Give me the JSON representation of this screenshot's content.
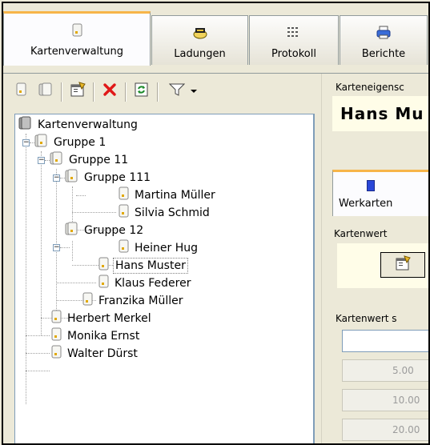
{
  "tabs": [
    {
      "label": "Kartenverwaltung",
      "icon": "card-icon",
      "active": true
    },
    {
      "label": "Ladungen",
      "icon": "charge-icon",
      "active": false
    },
    {
      "label": "Protokoll",
      "icon": "protocol-icon",
      "active": false
    },
    {
      "label": "Berichte",
      "icon": "printer-icon",
      "active": false
    }
  ],
  "toolbar": {
    "buttons": [
      "new-card-icon",
      "new-group-icon",
      "properties-icon",
      "delete-icon",
      "refresh-icon",
      "filter-icon",
      "dropdown-arrow-icon"
    ]
  },
  "tree": {
    "root": "Kartenverwaltung",
    "gruppe1": "Gruppe 1",
    "gruppe11": "Gruppe 11",
    "gruppe111": "Gruppe 111",
    "martina": "Martina Müller",
    "silvia": "Silvia Schmid",
    "gruppe12": "Gruppe 12",
    "heiner": "Heiner Hug",
    "hans": "Hans Muster",
    "klaus": "Klaus Federer",
    "franzika": "Franzika Müller",
    "herbert": "Herbert Merkel",
    "monika": "Monika Ernst",
    "walter": "Walter Dürst"
  },
  "right": {
    "props_label": "Karteneigensc",
    "name": "Hans Mu",
    "subtab_label": "Werkarten",
    "cw_label": "Kartenwert",
    "cws_label": "Kartenwert s",
    "values": [
      "5.00",
      "10.00",
      "20.00"
    ]
  },
  "colors": {
    "accent": "#f7b549",
    "selection_border": "#808080",
    "panel_bg": "#ece9d8",
    "highlight_bg": "#fffde8"
  }
}
